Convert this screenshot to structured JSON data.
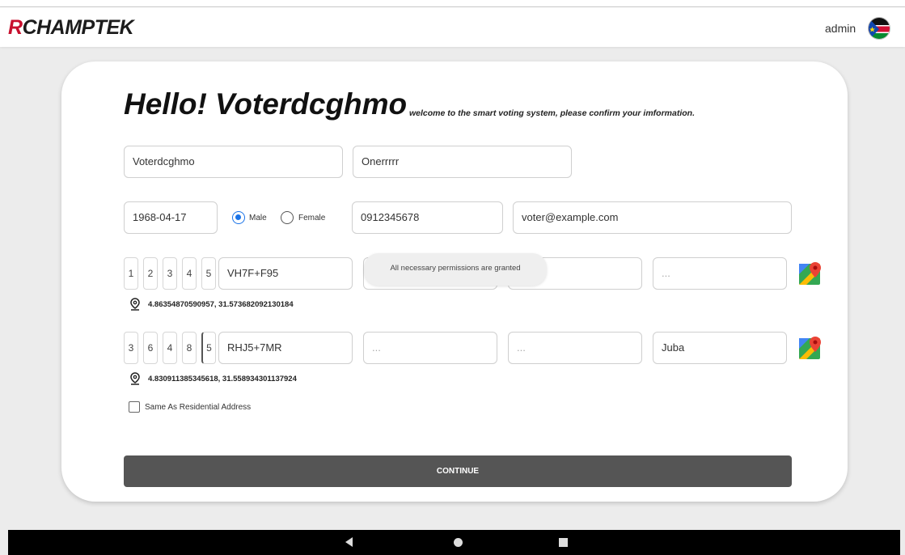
{
  "header": {
    "logo_prefix": "R",
    "logo_rest": "CHAMPTEK",
    "user_label": "admin",
    "avatar_icon": "south-sudan-flag-icon"
  },
  "form": {
    "greeting": "Hello! Voterdcghmo",
    "subtitle": "welcome to the smart voting system, please confirm your imformation.",
    "first_name": "Voterdcghmo",
    "last_name": "Onerrrrr",
    "birth_date": "1968-04-17",
    "gender_options": [
      "Male",
      "Female"
    ],
    "gender_selected": "Male",
    "phone": "0912345678",
    "email": "voter@example.com",
    "residential": {
      "digits": [
        "1",
        "2",
        "3",
        "4",
        "5"
      ],
      "plus_code": "VH7F+F95",
      "field2": "",
      "field3": "",
      "field4": "...",
      "coordinates": "4.86354870590957, 31.573682092130184"
    },
    "other_address": {
      "digits": [
        "3",
        "6",
        "4",
        "8",
        "5"
      ],
      "plus_code": "RHJ5+7MR",
      "field2": "...",
      "field3": "...",
      "city": "Juba",
      "coordinates": "4.830911385345618, 31.558934301137924"
    },
    "same_as_label": "Same As Residential Address",
    "continue_label": "CONTINUE"
  },
  "toast": "All necessary permissions are granted",
  "icons": {
    "location": "location-pin-icon",
    "maps": "google-maps-icon"
  },
  "colors": {
    "accent": "#1a73e8",
    "button": "#555555",
    "logo_red": "#c8102e"
  }
}
